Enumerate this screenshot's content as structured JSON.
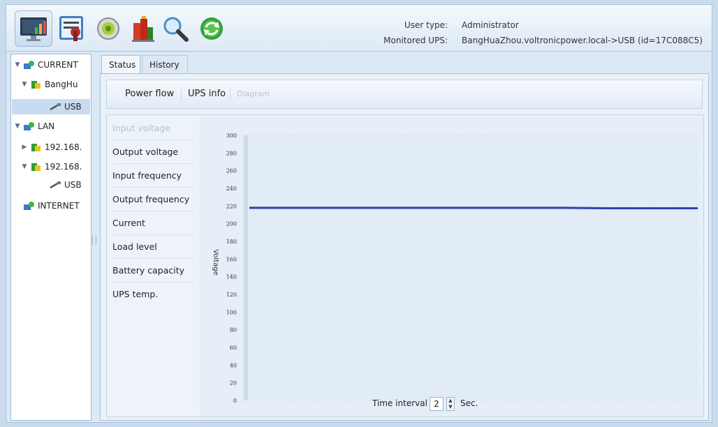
{
  "header": {
    "user_type_label": "User type:",
    "user_type_value": "Administrator",
    "monitored_label": "Monitored UPS:",
    "monitored_value": "BangHuaZhou.voltronicpower.local->USB (id=17C088C5)",
    "toolbar_icons": [
      "monitor-icon",
      "settings-tools-icon",
      "control-icon",
      "data-log-icon",
      "search-icon",
      "refresh-icon"
    ]
  },
  "tree": {
    "nodes": [
      {
        "label": "CURRENT",
        "expanded": true
      },
      {
        "label": "BangHu",
        "expanded": true
      },
      {
        "label": "USB",
        "selected": true
      },
      {
        "label": "LAN",
        "expanded": true
      },
      {
        "label": "192.168.",
        "expanded": false
      },
      {
        "label": "192.168.",
        "expanded": true
      },
      {
        "label": "USB",
        "selected": false
      },
      {
        "label": "INTERNET"
      }
    ]
  },
  "tabs": [
    {
      "label": "Status",
      "active": true
    },
    {
      "label": "History",
      "active": false
    }
  ],
  "subnav": [
    {
      "label": "Power flow",
      "enabled": true
    },
    {
      "label": "UPS info",
      "enabled": true
    },
    {
      "label": "Diagram",
      "enabled": false
    }
  ],
  "metrics": [
    {
      "label": "Input voltage",
      "enabled": false
    },
    {
      "label": "Output voltage",
      "enabled": true
    },
    {
      "label": "Input frequency",
      "enabled": true
    },
    {
      "label": "Output frequency",
      "enabled": true
    },
    {
      "label": "Current",
      "enabled": true
    },
    {
      "label": "Load level",
      "enabled": true
    },
    {
      "label": "Battery capacity",
      "enabled": true
    },
    {
      "label": "UPS temp.",
      "enabled": true
    }
  ],
  "chart_data": {
    "type": "line",
    "title": "",
    "ylabel": "Voltage",
    "ylim": [
      0,
      300
    ],
    "yticks": [
      0,
      20,
      40,
      60,
      80,
      100,
      120,
      140,
      160,
      180,
      200,
      220,
      240,
      260,
      280,
      300
    ],
    "series": [
      {
        "color": "#2f3fb3",
        "values": [
          218,
          218,
          218,
          218,
          218,
          218,
          218,
          218,
          217.5,
          217.5,
          217.5
        ]
      }
    ],
    "grid": true
  },
  "footer": {
    "time_interval_label": "Time interval",
    "time_interval_value": "2",
    "unit": "Sec."
  },
  "colors": {
    "accent": "#2f3fb3",
    "selection": "#c8dcf1"
  }
}
